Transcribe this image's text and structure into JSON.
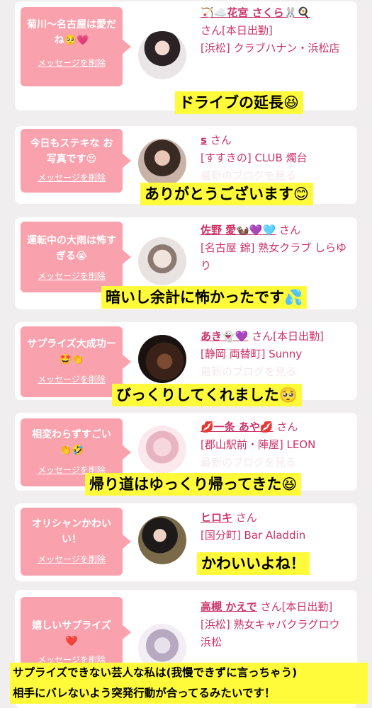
{
  "cards": [
    {
      "message": "菊川〜名古屋は愛だね🥺💗",
      "delete_label": "メッセージを削除",
      "name": "🏹☁️花宮 さくら🐰🍳",
      "san": "さん",
      "status": "[本日出勤]",
      "shop": "[浜松] クラブハナン・浜松店",
      "caption": "ドライブの延長😆"
    },
    {
      "message": "今日もステキな お写真です😍",
      "delete_label": "メッセージを削除",
      "name": "s",
      "san": "さん",
      "shop": "[すすきの] CLUB 燭台",
      "latest": "最新のブログを見る",
      "caption": "ありがとうございます😊"
    },
    {
      "message": "運転中の大雨は怖すぎる😭",
      "delete_label": "メッセージを削除",
      "name": "佐野 愛🦦💜🩵",
      "san": "さん",
      "shop": "[名古屋 錦] 熟女クラブ しらゆり",
      "caption": "暗いし余計に怖かったです💦"
    },
    {
      "message": "サプライズ大成功ー🤩👏",
      "delete_label": "メッセージを削除",
      "name": "あき👻💜",
      "san": "さん",
      "status": "[本日出勤]",
      "shop": "[静岡 両替町] Sunny",
      "latest": "最新のブログを見る",
      "caption": "びっくりしてくれました🥺"
    },
    {
      "message": "相変わらずすごい👏🤣",
      "delete_label": "メッセージを削除",
      "name": "💋一条 あや💋",
      "san": "さん",
      "shop": "[郡山駅前・陣屋] LEON",
      "latest": "最新のブログを見る",
      "caption": "帰り道はゆっくり帰ってきた😆"
    },
    {
      "message": "オリシャンかわいい！",
      "delete_label": "メッセージを削除",
      "name": "ヒロキ",
      "san": "さん",
      "shop": "[国分町] Bar Aladdin",
      "caption": "かわいいよね！"
    },
    {
      "message": "嬉しいサプライズ❤️",
      "delete_label": "メッセージを削除",
      "name": "高槻 かえで",
      "san": "さん",
      "status": "[本日出勤]",
      "shop": "[浜松] 熟女キャバクラグロウ 浜松"
    }
  ],
  "footer": {
    "line1": "サプライズできない芸人な私は(我慢できずに言っちゃう)",
    "line2": "相手にバレないよう突発行動が合ってるみたいです！"
  },
  "colors": {
    "bubble": "#f9a2ae",
    "name": "#cc3366",
    "highlight": "#fffb3a",
    "background": "#f0eeee"
  }
}
